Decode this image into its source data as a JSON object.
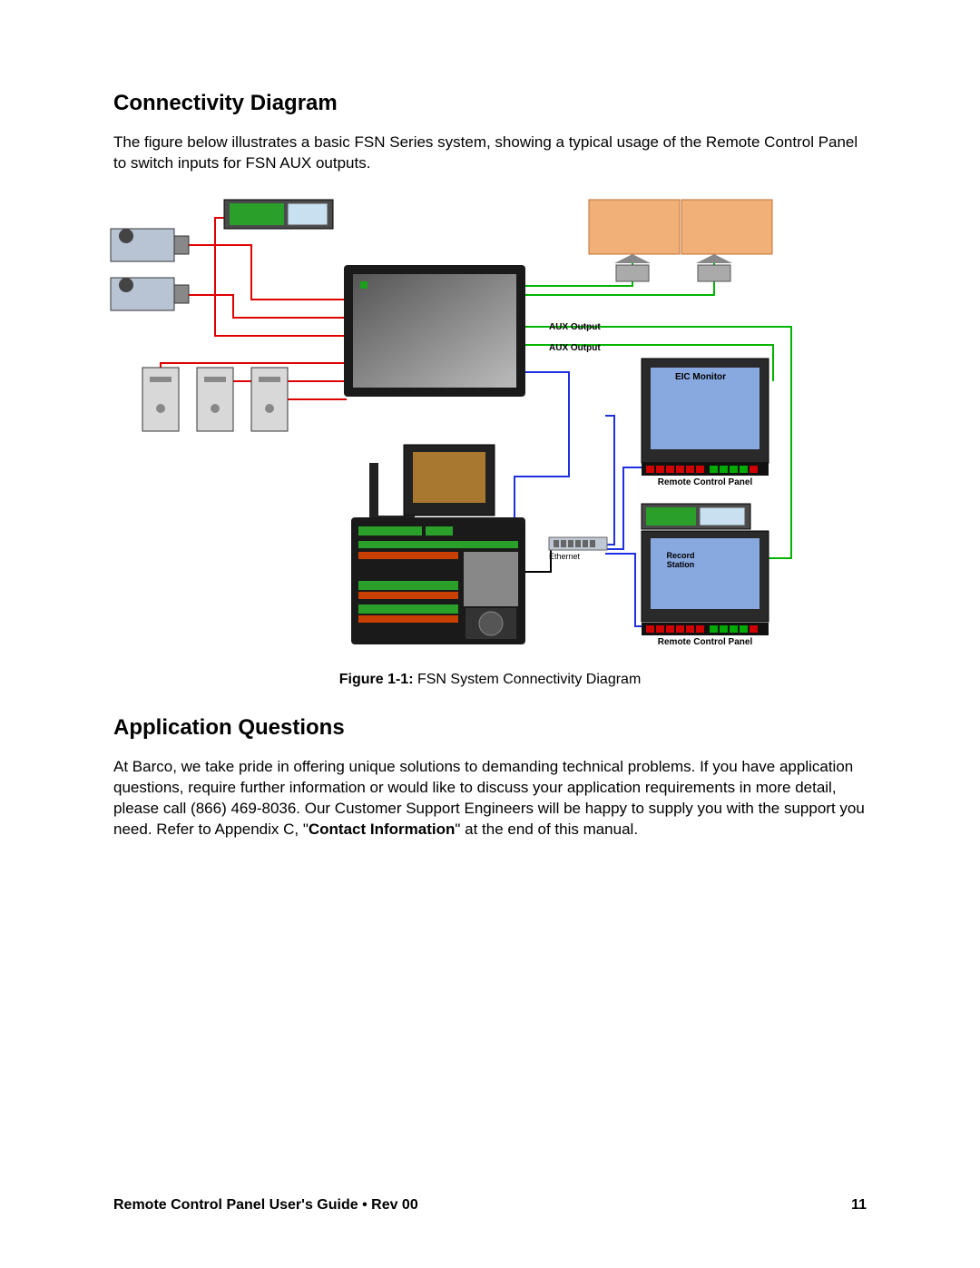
{
  "heading1": "Connectivity Diagram",
  "intro": "The figure below illustrates a basic FSN Series system, showing a typical usage of the Remote Control Panel to switch inputs for FSN AUX outputs.",
  "labels": {
    "aux1": "AUX Output",
    "aux2": "AUX Output",
    "eic": "EIC Monitor",
    "rcp1": "Remote Control Panel",
    "rcp2": "Remote Control Panel",
    "eth": "Ethernet",
    "rec": "Record\nStation"
  },
  "figure_bold": "Figure 1-1:",
  "figure_text": " FSN System Connectivity Diagram",
  "heading2": "Application Questions",
  "body2a": "At Barco, we take pride in offering unique solutions to demanding technical problems. If you have application questions, require further information or would like to discuss your application requirements in more detail, please call (866) 469-8036. Our Customer Support Engineers will be happy to supply you with the support you need. Refer to Appendix C, \"",
  "body2b": "Contact Information",
  "body2c": "\" at the end of this manual.",
  "footer_left": "Remote Control Panel User's Guide • Rev 00",
  "footer_right": "11"
}
